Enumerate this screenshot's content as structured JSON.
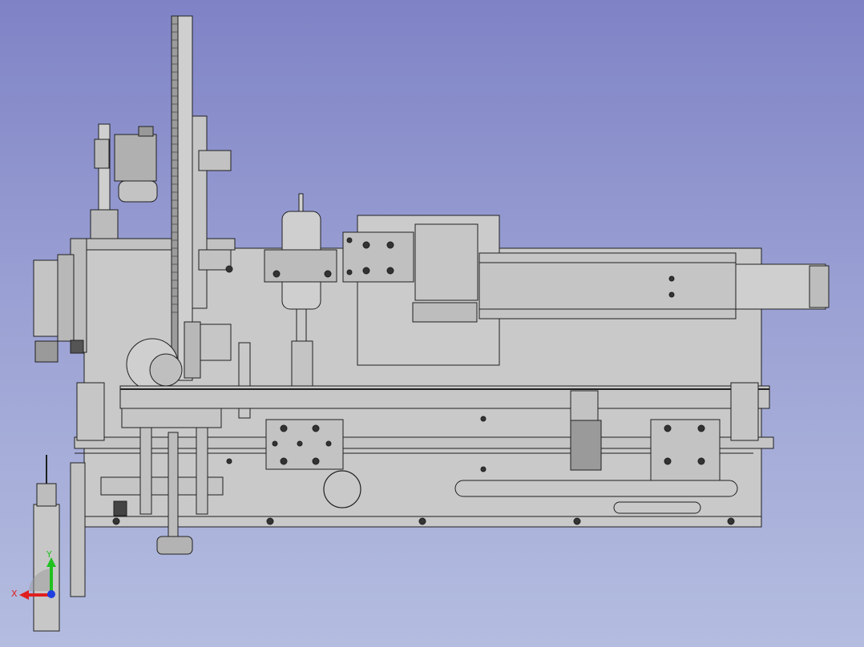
{
  "view": {
    "background_top": "#7f83c6",
    "background_bottom": "#b4bde0",
    "part_fill": "#c8c8c8",
    "part_stroke": "#202020"
  },
  "triad": {
    "x_label": "X",
    "y_label": "Y",
    "x_color": "#e02020",
    "y_color": "#20c020",
    "z_color": "#2040e0"
  }
}
